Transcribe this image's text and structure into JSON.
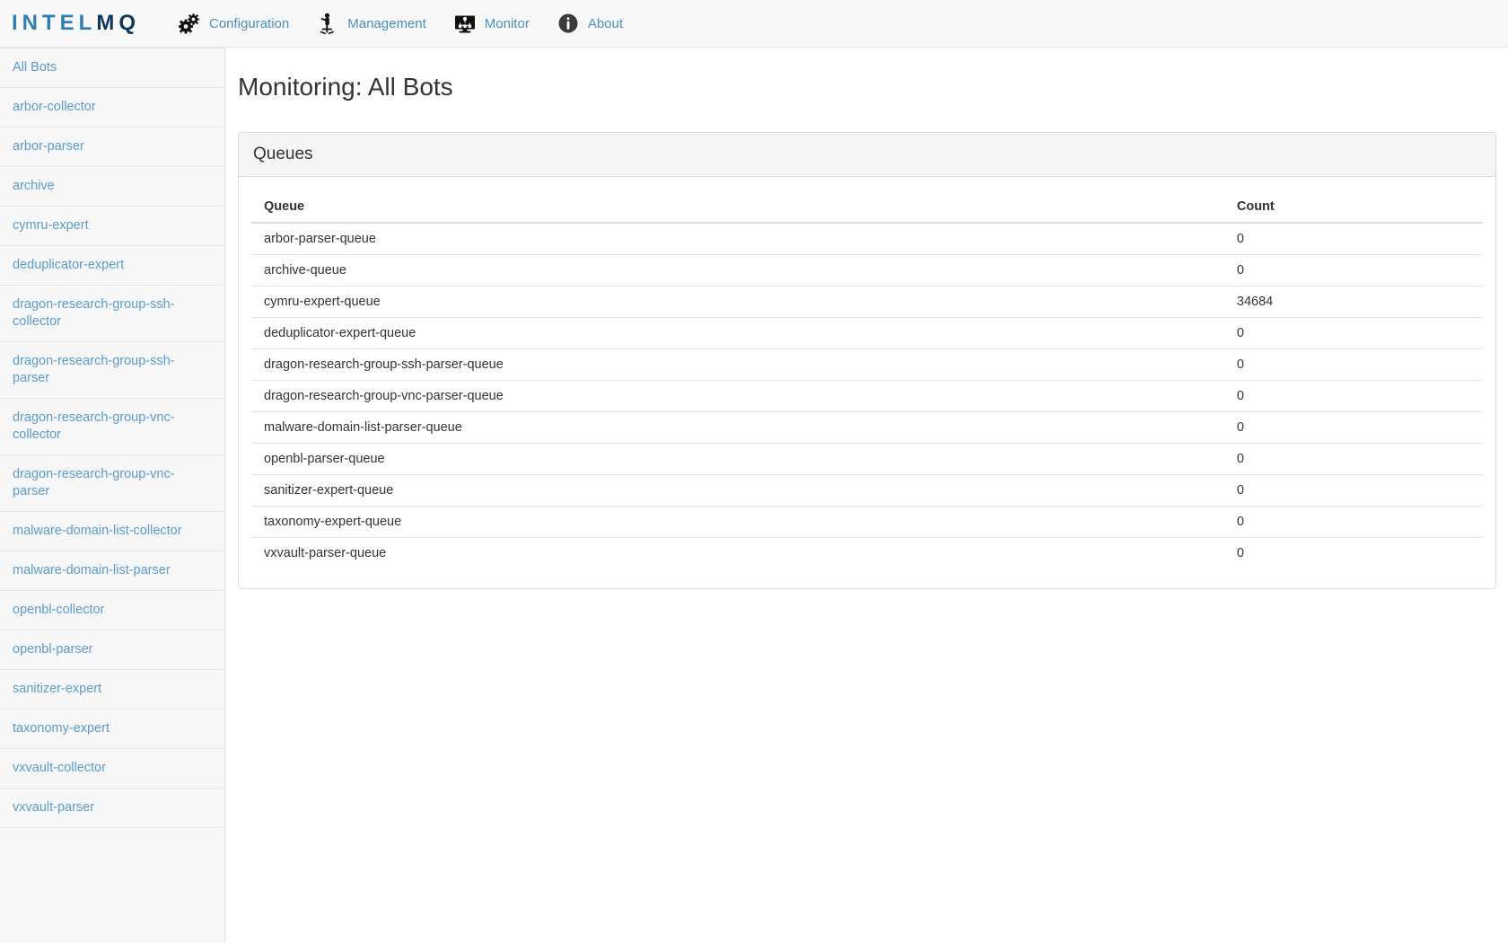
{
  "brand": {
    "text_light": "INTEL",
    "text_dark": "MQ",
    "full": "INTELMQ"
  },
  "nav": {
    "items": [
      {
        "label": "Configuration",
        "icon": "gears-icon"
      },
      {
        "label": "Management",
        "icon": "person-chair-icon"
      },
      {
        "label": "Monitor",
        "icon": "monitor-network-icon"
      },
      {
        "label": "About",
        "icon": "info-circle-icon"
      }
    ]
  },
  "sidebar": {
    "items": [
      {
        "label": "All Bots"
      },
      {
        "label": "arbor-collector"
      },
      {
        "label": "arbor-parser"
      },
      {
        "label": "archive"
      },
      {
        "label": "cymru-expert"
      },
      {
        "label": "deduplicator-expert"
      },
      {
        "label": "dragon-research-group-ssh-collector"
      },
      {
        "label": "dragon-research-group-ssh-parser"
      },
      {
        "label": "dragon-research-group-vnc-collector"
      },
      {
        "label": "dragon-research-group-vnc-parser"
      },
      {
        "label": "malware-domain-list-collector"
      },
      {
        "label": "malware-domain-list-parser"
      },
      {
        "label": "openbl-collector"
      },
      {
        "label": "openbl-parser"
      },
      {
        "label": "sanitizer-expert"
      },
      {
        "label": "taxonomy-expert"
      },
      {
        "label": "vxvault-collector"
      },
      {
        "label": "vxvault-parser"
      }
    ]
  },
  "main": {
    "page_title": "Monitoring: All Bots",
    "panel": {
      "title": "Queues",
      "table": {
        "columns": [
          "Queue",
          "Count"
        ],
        "rows": [
          {
            "queue": "arbor-parser-queue",
            "count": "0"
          },
          {
            "queue": "archive-queue",
            "count": "0"
          },
          {
            "queue": "cymru-expert-queue",
            "count": "34684"
          },
          {
            "queue": "deduplicator-expert-queue",
            "count": "0"
          },
          {
            "queue": "dragon-research-group-ssh-parser-queue",
            "count": "0"
          },
          {
            "queue": "dragon-research-group-vnc-parser-queue",
            "count": "0"
          },
          {
            "queue": "malware-domain-list-parser-queue",
            "count": "0"
          },
          {
            "queue": "openbl-parser-queue",
            "count": "0"
          },
          {
            "queue": "sanitizer-expert-queue",
            "count": "0"
          },
          {
            "queue": "taxonomy-expert-queue",
            "count": "0"
          },
          {
            "queue": "vxvault-parser-queue",
            "count": "0"
          }
        ]
      }
    }
  },
  "colors": {
    "link": "#5a9bd4",
    "nav_link": "#4a90c4",
    "brand_light": "#2e7fb0",
    "brand_dark": "#11365a",
    "navbar_bg": "#f8f8f8",
    "sidebar_bg": "#f7f7f7",
    "panel_head_bg": "#f5f5f5",
    "border": "#dddddd"
  }
}
